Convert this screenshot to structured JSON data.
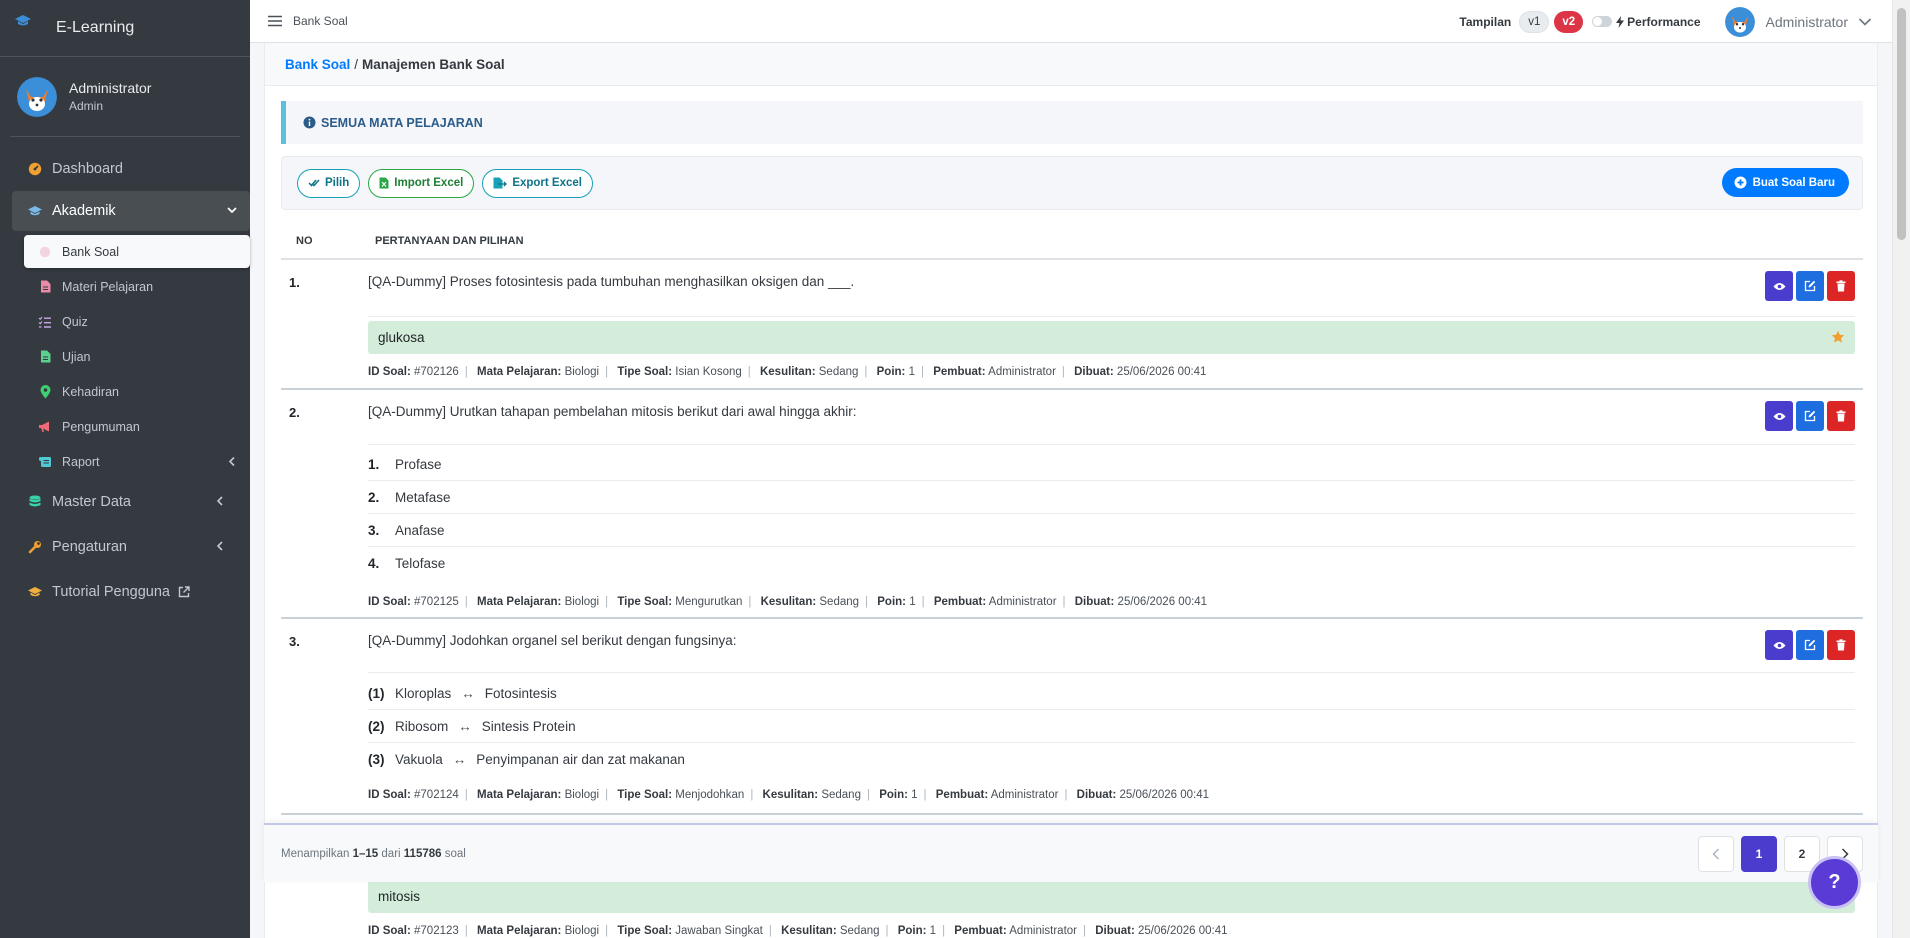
{
  "sidebar": {
    "brand": "E-Learning",
    "user": {
      "name": "Administrator",
      "role": "Admin"
    },
    "items": [
      {
        "label": "Dashboard"
      },
      {
        "label": "Akademik"
      },
      {
        "label": "Master Data"
      },
      {
        "label": "Pengaturan"
      },
      {
        "label": "Tutorial Pengguna"
      }
    ],
    "sub_items": [
      {
        "label": "Bank Soal"
      },
      {
        "label": "Materi Pelajaran"
      },
      {
        "label": "Quiz"
      },
      {
        "label": "Ujian"
      },
      {
        "label": "Kehadiran"
      },
      {
        "label": "Pengumuman"
      },
      {
        "label": "Raport"
      }
    ]
  },
  "topbar": {
    "title": "Bank Soal",
    "tampilan": "Tampilan",
    "v1": "v1",
    "v2": "v2",
    "performance": "Performance",
    "user": "Administrator"
  },
  "breadcrumb": {
    "link": "Bank Soal",
    "sep": "/",
    "current": "Manajemen Bank Soal"
  },
  "callout": "SEMUA MATA PELAJARAN",
  "toolbar": {
    "pilih": "Pilih",
    "import": "Import Excel",
    "export": "Export Excel",
    "new": "Buat Soal Baru"
  },
  "table": {
    "col_no": "NO",
    "col_question": "PERTANYAAN DAN PILIHAN"
  },
  "meta_labels": {
    "id": "ID Soal:",
    "subject": "Mata Pelajaran:",
    "type": "Tipe Soal:",
    "difficulty": "Kesulitan:",
    "points": "Poin:",
    "creator": "Pembuat:",
    "created": "Dibuat:"
  },
  "questions": [
    {
      "no": "1.",
      "text": "[QA-Dummy] Proses fotosintesis pada tumbuhan menghasilkan oksigen dan ___.",
      "answer": "glukosa",
      "meta": {
        "id": "#702126",
        "subject": "Biologi",
        "type": "Isian Kosong",
        "difficulty": "Sedang",
        "points": "1",
        "creator": "Administrator",
        "created": "25/06/2026 00:41"
      }
    },
    {
      "no": "2.",
      "text": "[QA-Dummy] Urutkan tahapan pembelahan mitosis berikut dari awal hingga akhir:",
      "options": [
        {
          "num": "1.",
          "text": "Profase"
        },
        {
          "num": "2.",
          "text": "Metafase"
        },
        {
          "num": "3.",
          "text": "Anafase"
        },
        {
          "num": "4.",
          "text": "Telofase"
        }
      ],
      "meta": {
        "id": "#702125",
        "subject": "Biologi",
        "type": "Mengurutkan",
        "difficulty": "Sedang",
        "points": "1",
        "creator": "Administrator",
        "created": "25/06/2026 00:41"
      }
    },
    {
      "no": "3.",
      "text": "[QA-Dummy] Jodohkan organel sel berikut dengan fungsinya:",
      "pairs": [
        {
          "num": "(1)",
          "left": "Kloroplas",
          "arrow": "↔",
          "right": "Fotosintesis"
        },
        {
          "num": "(2)",
          "left": "Ribosom",
          "arrow": "↔",
          "right": "Sintesis Protein"
        },
        {
          "num": "(3)",
          "left": "Vakuola",
          "arrow": "↔",
          "right": "Penyimpanan air dan zat makanan"
        }
      ],
      "meta": {
        "id": "#702124",
        "subject": "Biologi",
        "type": "Menjodohkan",
        "difficulty": "Sedang",
        "points": "1",
        "creator": "Administrator",
        "created": "25/06/2026 00:41"
      }
    },
    {
      "answer": "mitosis",
      "meta": {
        "id": "#702123",
        "subject": "Biologi",
        "type": "Jawaban Singkat",
        "difficulty": "Sedang",
        "points": "1",
        "creator": "Administrator",
        "created": "25/06/2026 00:41"
      }
    }
  ],
  "pagination": {
    "prefix": "Menampilkan",
    "range": "1–15",
    "of": "dari",
    "total": "115786",
    "suffix": "soal",
    "pages": [
      "1",
      "2"
    ]
  },
  "help": "?",
  "colors": {
    "sidebar": "#343a40",
    "primary": "#007bff",
    "accent": "#4a3ccc",
    "danger": "#dc2626",
    "answer_bg": "#d4eddb"
  }
}
